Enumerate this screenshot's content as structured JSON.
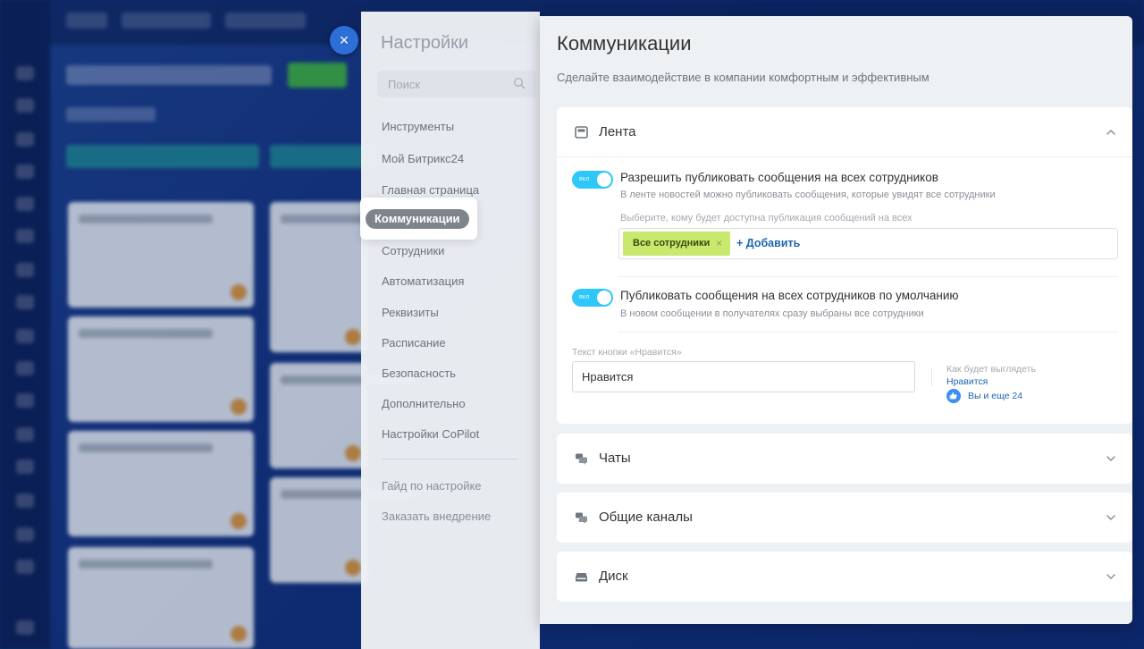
{
  "settings": {
    "title": "Настройки",
    "search_placeholder": "Поиск",
    "nav_items": [
      {
        "label": "Инструменты"
      },
      {
        "label": "Мой Битрикс24"
      },
      {
        "label": "Главная страница"
      },
      {
        "label": "Коммуникации",
        "active": true
      },
      {
        "label": "Сотрудники"
      },
      {
        "label": "Автоматизация"
      },
      {
        "label": "Реквизиты"
      },
      {
        "label": "Расписание"
      },
      {
        "label": "Безопасность"
      },
      {
        "label": "Дополнительно"
      },
      {
        "label": "Настройки CoPilot"
      }
    ],
    "secondary_links": [
      {
        "label": "Гайд по настройке"
      },
      {
        "label": "Заказать внедрение"
      }
    ]
  },
  "page": {
    "title": "Коммуникации",
    "subtitle": "Сделайте взаимодействие в компании комфортным и эффективным"
  },
  "lenta": {
    "title": "Лента",
    "expanded": true,
    "option1": {
      "toggle_label": "вкл",
      "enabled": true,
      "title": "Разрешить публиковать сообщения на всех сотрудников",
      "description": "В ленте новостей можно публиковать сообщения, которые увидят все сотрудники"
    },
    "audience": {
      "hint": "Выберите, кому будет доступна публикация сообщений на всех",
      "tag": "Все сотрудники",
      "tag_remove": "×",
      "add_label": "+ Добавить"
    },
    "option2": {
      "toggle_label": "вкл",
      "enabled": true,
      "title": "Публиковать сообщения на всех сотрудников по умолчанию",
      "description": "В новом сообщении в получателях сразу выбраны все сотрудники"
    },
    "like_button": {
      "label": "Текст кнопки «Нравится»",
      "value": "Нравится",
      "preview_label": "Как будет выглядеть",
      "preview_link": "Нравится",
      "preview_count": "Вы и еще 24"
    }
  },
  "sections": {
    "chats": {
      "title": "Чаты",
      "expanded": false
    },
    "channels": {
      "title": "Общие каналы",
      "expanded": false
    },
    "disk": {
      "title": "Диск",
      "expanded": false
    }
  },
  "close_glyph": "×",
  "colors": {
    "toggle_on": "#2fc7f7",
    "tag_bg": "#c9e86e",
    "link": "#2067b0",
    "active_pill": "#7d848b",
    "close_button": "#2d6fd6"
  }
}
